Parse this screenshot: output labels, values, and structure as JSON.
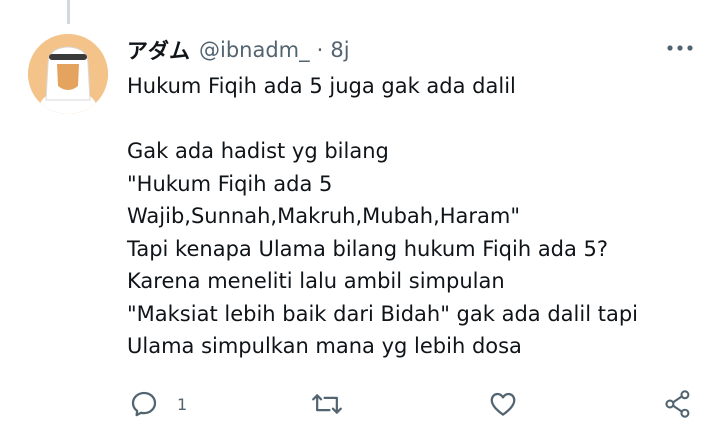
{
  "tweet": {
    "display_name": "アダム",
    "handle": "@ibnadm_",
    "separator": "·",
    "time": "8j",
    "lines": [
      "Hukum Fiqih ada 5 juga gak ada dalil",
      "",
      "Gak ada hadist yg bilang",
      "\"Hukum Fiqih ada 5",
      "Wajib,Sunnah,Makruh,Mubah,Haram\"",
      "Tapi kenapa Ulama bilang hukum Fiqih ada 5?",
      "Karena meneliti lalu ambil simpulan",
      "\"Maksiat lebih baik dari Bidah\" gak ada dalil tapi",
      "Ulama simpulkan mana yg lebih dosa"
    ]
  },
  "actions": {
    "reply_count": "1"
  },
  "colors": {
    "text_primary": "#0f1419",
    "text_secondary": "#536471",
    "icon": "#536471",
    "thread_line": "#cfd9de",
    "avatar_bg": "#f3c389"
  },
  "icons": {
    "more": "more-horizontal-icon",
    "reply": "reply-icon",
    "retweet": "retweet-icon",
    "like": "heart-icon",
    "share": "share-icon"
  }
}
